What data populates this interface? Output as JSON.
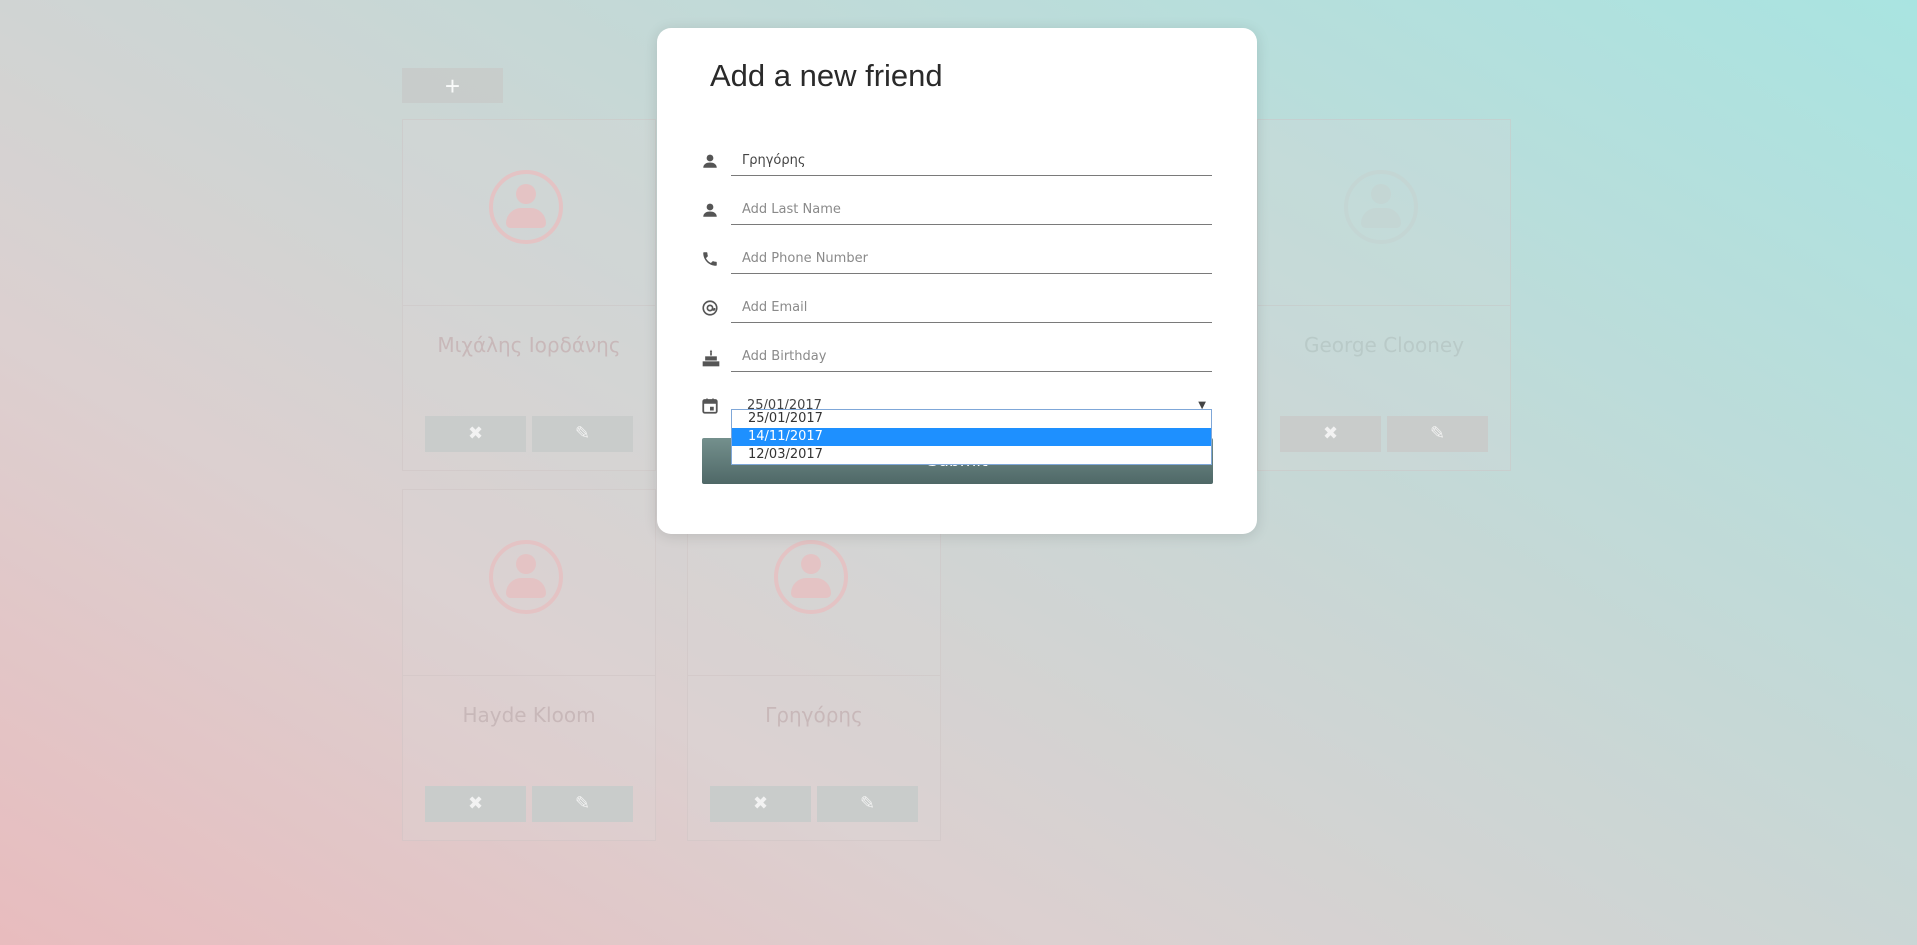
{
  "toolbar": {
    "add_label": "+"
  },
  "friends": [
    {
      "name": "Μιχάλης Ιορδάνης",
      "delete": "✖",
      "edit": "✎"
    },
    {
      "name": "George Clooney",
      "delete": "✖",
      "edit": "✎"
    },
    {
      "name": "Hayde Kloom",
      "delete": "✖",
      "edit": "✎"
    },
    {
      "name": "Γρηγόρης",
      "delete": "✖",
      "edit": "✎"
    }
  ],
  "modal": {
    "title": "Add a new friend",
    "first_name_value": "Γρηγόρης",
    "last_name_placeholder": "Add Last Name",
    "phone_placeholder": "Add Phone Number",
    "email_placeholder": "Add Email",
    "birthday_placeholder": "Add Birthday",
    "date_selected": "25/01/2017",
    "date_options": [
      "25/01/2017",
      "14/11/2017",
      "12/03/2017"
    ],
    "highlighted_option": "14/11/2017",
    "submit_label": "Submit"
  },
  "colors": {
    "submit_top": "#74908d",
    "submit_bottom": "#4f6867",
    "highlight": "#1e90ff"
  },
  "icons": [
    "person-icon",
    "person-icon",
    "phone-icon",
    "at-icon",
    "cake-icon",
    "calendar-icon"
  ]
}
